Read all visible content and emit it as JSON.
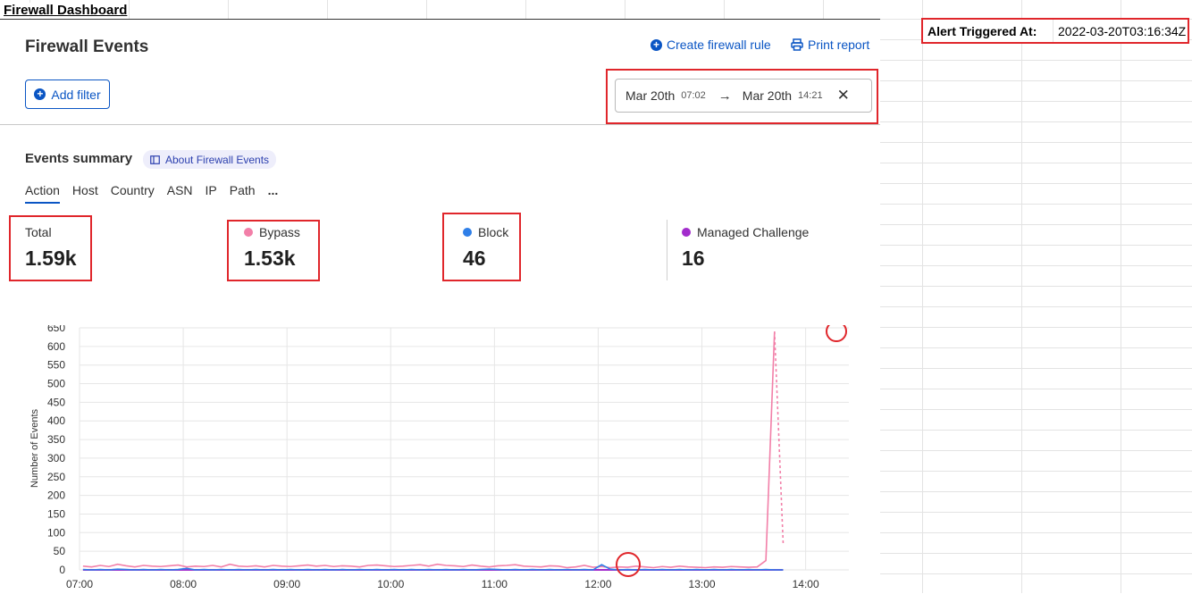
{
  "sheet": {
    "title": "Firewall Dashboard",
    "alert_label": "Alert Triggered At:",
    "alert_value": "2022-03-20T03:16:34Z"
  },
  "panel": {
    "title": "Firewall Events",
    "create_rule": "Create firewall rule",
    "print_report": "Print report",
    "add_filter": "Add filter",
    "date_from": "Mar 20th",
    "time_from": "07:02",
    "date_to": "Mar 20th",
    "time_to": "14:21"
  },
  "summary": {
    "title": "Events summary",
    "about": "About Firewall Events",
    "tabs": [
      "Action",
      "Host",
      "Country",
      "ASN",
      "IP",
      "Path",
      "..."
    ],
    "stats": [
      {
        "label": "Total",
        "value": "1.59k",
        "color": ""
      },
      {
        "label": "Bypass",
        "value": "1.53k",
        "color": "#f27fa8"
      },
      {
        "label": "Block",
        "value": "46",
        "color": "#2f7fe8"
      },
      {
        "label": "Managed Challenge",
        "value": "16",
        "color": "#a22ccc"
      }
    ]
  },
  "chart_data": {
    "type": "line",
    "ylabel": "Number of Events",
    "xlabel": "",
    "ylim": [
      0,
      650
    ],
    "yticks": [
      0,
      50,
      100,
      150,
      200,
      250,
      300,
      350,
      400,
      450,
      500,
      550,
      600,
      650
    ],
    "xticks": [
      "07:00",
      "08:00",
      "09:00",
      "10:00",
      "11:00",
      "12:00",
      "13:00",
      "14:00"
    ],
    "x_start_minutes": 422,
    "x_step_minutes": 5,
    "series": [
      {
        "name": "Bypass",
        "color": "#f27fa8",
        "values": [
          10,
          8,
          12,
          9,
          15,
          11,
          8,
          12,
          10,
          9,
          11,
          13,
          8,
          10,
          9,
          12,
          8,
          15,
          10,
          9,
          11,
          8,
          12,
          10,
          9,
          11,
          13,
          10,
          12,
          9,
          11,
          10,
          8,
          12,
          13,
          11,
          9,
          10,
          12,
          14,
          10,
          15,
          12,
          11,
          9,
          13,
          10,
          8,
          11,
          12,
          14,
          10,
          9,
          8,
          11,
          10,
          6,
          8,
          12,
          7,
          9,
          6,
          8,
          7,
          10,
          8,
          6,
          9,
          7,
          10,
          8,
          7,
          6,
          8,
          7,
          9,
          8,
          7,
          8,
          25,
          640,
          70
        ]
      },
      {
        "name": "Block",
        "color": "#2f7fe8",
        "values": [
          1,
          0,
          1,
          0,
          2,
          1,
          0,
          1,
          0,
          1,
          0,
          1,
          4,
          0,
          1,
          0,
          1,
          0,
          1,
          0,
          1,
          0,
          1,
          0,
          1,
          0,
          1,
          0,
          1,
          0,
          1,
          0,
          1,
          0,
          1,
          0,
          1,
          0,
          1,
          0,
          1,
          0,
          1,
          0,
          1,
          0,
          1,
          2,
          1,
          0,
          1,
          0,
          1,
          0,
          1,
          0,
          1,
          0,
          1,
          0,
          14,
          2,
          0,
          1,
          0,
          1,
          0,
          1,
          0,
          1,
          0,
          1,
          0,
          1,
          0,
          1,
          0,
          1,
          0,
          1,
          0,
          0
        ]
      },
      {
        "name": "Managed Challenge",
        "color": "#a22ccc",
        "values": [
          0,
          0,
          0,
          0,
          0,
          0,
          0,
          0,
          0,
          0,
          0,
          0,
          0,
          0,
          0,
          0,
          0,
          0,
          0,
          0,
          0,
          0,
          0,
          0,
          0,
          0,
          0,
          0,
          0,
          0,
          0,
          0,
          0,
          0,
          0,
          0,
          0,
          0,
          0,
          0,
          0,
          0,
          0,
          0,
          0,
          0,
          0,
          0,
          0,
          0,
          0,
          0,
          0,
          0,
          0,
          0,
          0,
          0,
          0,
          0,
          0,
          0,
          0,
          0,
          0,
          0,
          0,
          0,
          0,
          0,
          0,
          0,
          0,
          0,
          0,
          0,
          0,
          0,
          0,
          0,
          0,
          0
        ]
      }
    ],
    "grid": true
  }
}
